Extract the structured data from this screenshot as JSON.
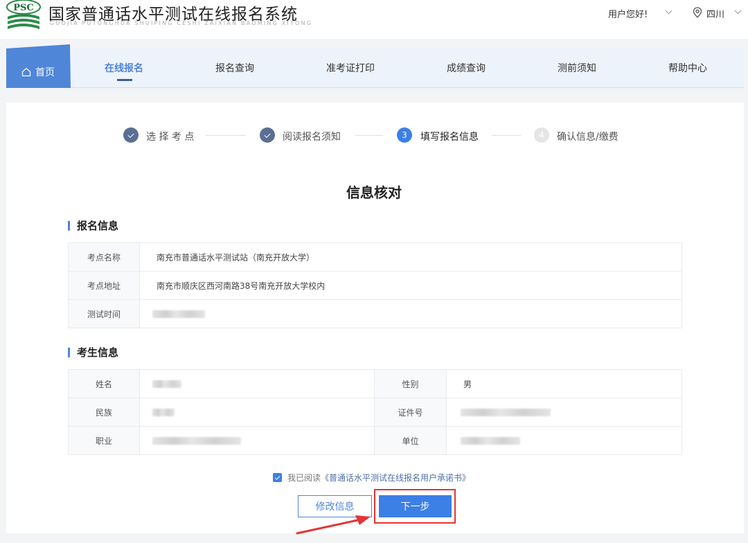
{
  "header": {
    "logo_text": "PSC",
    "title": "国家普通话水平测试在线报名系统",
    "subtitle": "GUOJIA PUTONGHUA SHUIPING CESHI ZAIXIAN BAOMING XITONG",
    "user_greeting": "用户您好!",
    "location": "四川"
  },
  "nav": {
    "home": "首页",
    "items": [
      "在线报名",
      "报名查询",
      "准考证打印",
      "成绩查询",
      "测前须知",
      "帮助中心"
    ]
  },
  "steps": [
    {
      "label": "选 择 考 点",
      "status": "done"
    },
    {
      "label": "阅读报名须知",
      "status": "done"
    },
    {
      "number": "3",
      "label": "填写报名信息",
      "status": "active"
    },
    {
      "number": "4",
      "label": "确认信息/缴费",
      "status": "todo"
    }
  ],
  "page_title": "信息核对",
  "registration": {
    "section_title": "报名信息",
    "rows": [
      {
        "label": "考点名称",
        "value": "南充市普通话水平测试站（南充开放大学）"
      },
      {
        "label": "考点地址",
        "value": "南充市顺庆区西河南路38号南充开放大学校内"
      },
      {
        "label": "测试时间",
        "value": ""
      }
    ]
  },
  "candidate": {
    "section_title": "考生信息",
    "rows": [
      {
        "label1": "姓名",
        "value1": "",
        "label2": "性别",
        "value2": "男"
      },
      {
        "label1": "民族",
        "value1": "",
        "label2": "证件号",
        "value2": ""
      },
      {
        "label1": "职业",
        "value1": "",
        "label2": "单位",
        "value2": ""
      }
    ]
  },
  "agreement": {
    "prefix": "我已阅读",
    "link": "《普通话水平测试在线报名用户承诺书》",
    "checked": true
  },
  "buttons": {
    "edit": "修改信息",
    "next": "下一步"
  },
  "colors": {
    "primary": "#3c7fe6",
    "nav_home": "#4f86d8",
    "annotation": "#e53333"
  }
}
